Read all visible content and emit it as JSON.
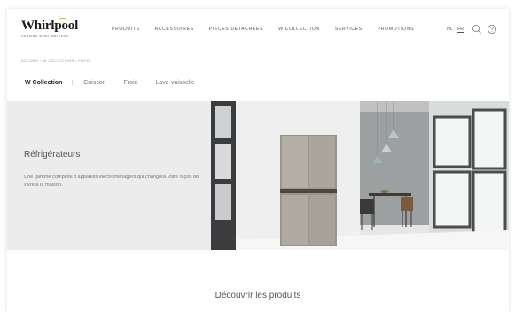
{
  "brand": {
    "name": "Whirlpool",
    "tagline": "Sensing what matters"
  },
  "nav": {
    "items": [
      "Produits",
      "Accessoires",
      "Pièces détachées",
      "W Collection",
      "Services",
      "Promotions"
    ]
  },
  "languages": {
    "options": [
      "NL",
      "FR"
    ],
    "selected": "FR"
  },
  "breadcrumb": {
    "text": "Accueil / W Collection / Froid"
  },
  "tabs": {
    "active": "W Collection",
    "items": [
      "Cuisson",
      "Froid",
      "Lave-vaisselle"
    ]
  },
  "hero": {
    "title": "Réfrigérateurs",
    "description": "Une gamme complète d'appareils électroménagers qui changera votre façon de vivre à la maison."
  },
  "discover": {
    "label": "Découvrir les produits"
  },
  "icons": {
    "search": "search-icon",
    "help": "help-icon"
  },
  "colors": {
    "accent": "#e1a400",
    "hero_bg": "#ececec"
  }
}
